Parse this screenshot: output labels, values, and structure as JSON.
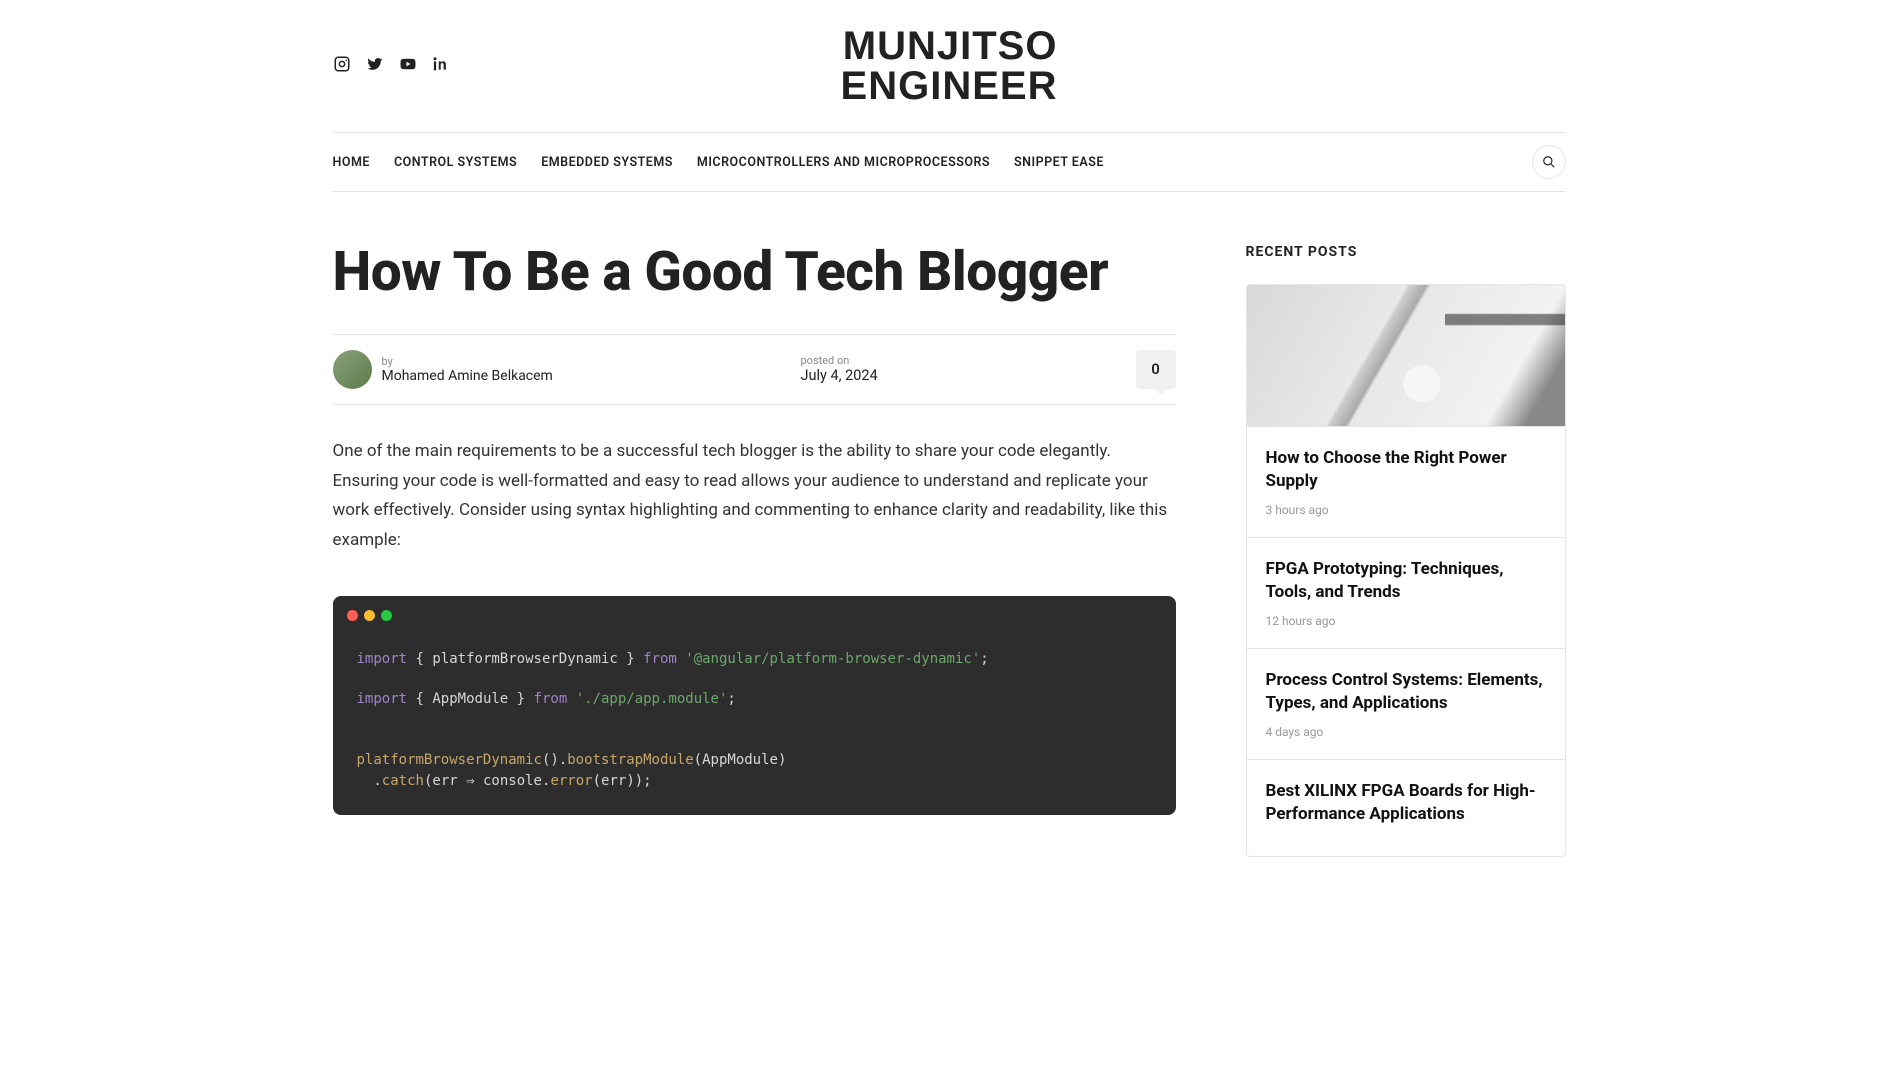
{
  "logo": {
    "line1": "MUNJITSO",
    "line2": "ENGINEER"
  },
  "social": {
    "instagram": "instagram",
    "twitter": "twitter",
    "youtube": "youtube",
    "linkedin": "linkedin"
  },
  "nav": {
    "items": [
      "HOME",
      "CONTROL SYSTEMS",
      "EMBEDDED SYSTEMS",
      "MICROCONTROLLERS AND MICROPROCESSORS",
      "SNIPPET EASE"
    ]
  },
  "article": {
    "title": "How To Be a Good Tech Blogger",
    "by_label": "by",
    "author": "Mohamed Amine Belkacem",
    "posted_label": "posted on",
    "date": "July 4, 2024",
    "comments": "0",
    "paragraph": "One of the main requirements to be a successful tech blogger is the ability to share your code elegantly. Ensuring your code is well-formatted and easy to read allows your audience to understand and replicate your work effectively. Consider using syntax highlighting and commenting to enhance clarity and readability, like this example:",
    "code": {
      "line1": {
        "kw1": "import",
        "open": " { ",
        "ident": "platformBrowserDynamic",
        "close": " } ",
        "kw2": "from",
        "sp": " ",
        "str": "'@angular/platform-browser-dynamic'",
        "semi": ";"
      },
      "line2": {
        "kw1": "import",
        "open": " { ",
        "ident": "AppModule",
        "close": " } ",
        "kw2": "from",
        "sp": " ",
        "str": "'./app/app.module'",
        "semi": ";"
      },
      "line4": {
        "fn1": "platformBrowserDynamic",
        "par1": "().",
        "fn2": "bootstrapModule",
        "par2": "(",
        "arg": "AppModule",
        "par3": ")"
      },
      "line5": {
        "indent": "  .",
        "fn": "catch",
        "open": "(",
        "param": "err",
        "arrow": " ⇒ ",
        "obj": "console",
        "dot": ".",
        "method": "error",
        "open2": "(",
        "param2": "err",
        "close": "));"
      }
    }
  },
  "sidebar": {
    "heading": "RECENT POSTS",
    "posts": [
      {
        "title": "How to Choose the Right Power Supply",
        "ago": "3 hours ago"
      },
      {
        "title": "FPGA Prototyping: Techniques, Tools, and Trends",
        "ago": "12 hours ago"
      },
      {
        "title": "Process Control Systems: Elements, Types, and Applications",
        "ago": "4 days ago"
      },
      {
        "title": "Best XILINX FPGA Boards for High-Performance Applications",
        "ago": ""
      }
    ]
  }
}
